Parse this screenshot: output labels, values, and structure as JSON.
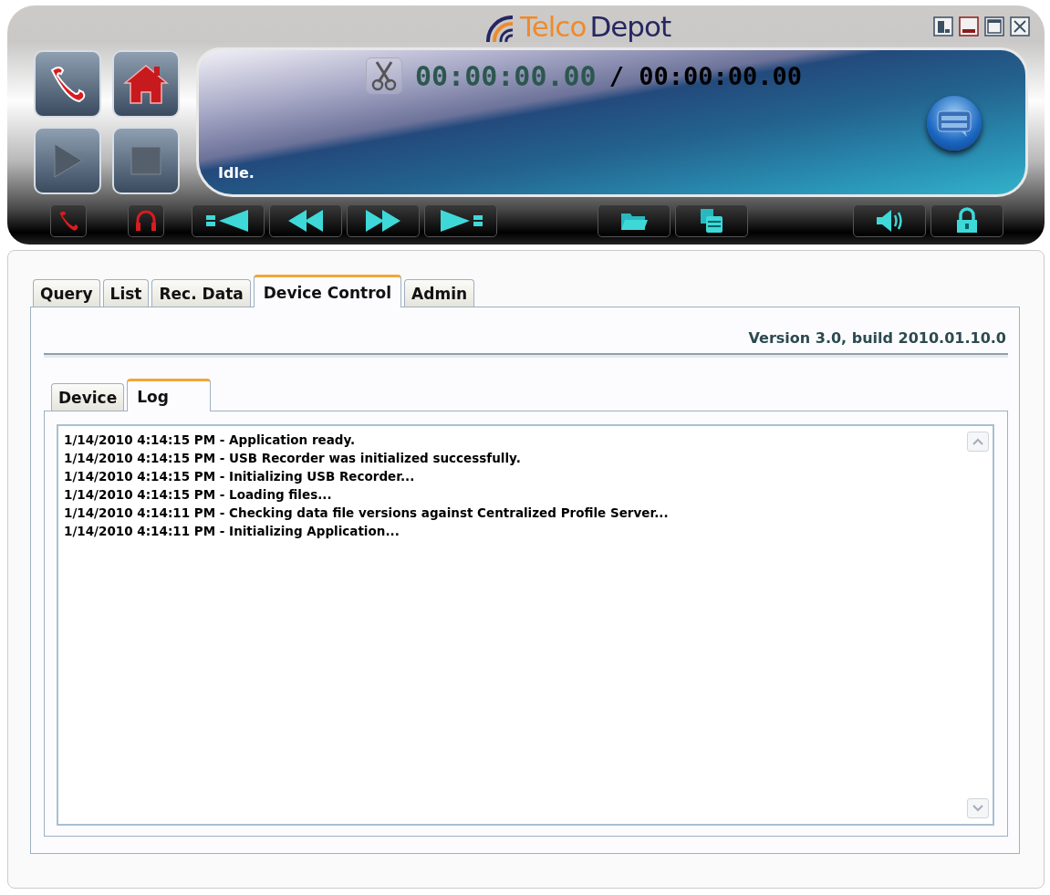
{
  "logo": {
    "part_1": "Telco",
    "part_2": "Depot"
  },
  "player": {
    "elapsed": "00:00:00.00",
    "total": "/ 00:00:00.00",
    "status": "Idle."
  },
  "tabs": [
    {
      "label": "Query",
      "selected": false
    },
    {
      "label": "List",
      "selected": false
    },
    {
      "label": "Rec. Data",
      "selected": false
    },
    {
      "label": "Device Control",
      "selected": true
    },
    {
      "label": "Admin",
      "selected": false
    }
  ],
  "version": "Version 3.0, build 2010.01.10.0",
  "subtabs": [
    {
      "label": "Device",
      "selected": false
    },
    {
      "label": "Log",
      "selected": true
    }
  ],
  "log": [
    "1/14/2010 4:14:15 PM - Application ready.",
    "1/14/2010 4:14:15 PM - USB Recorder was initialized successfully.",
    "1/14/2010 4:14:15 PM - Initializing USB Recorder...",
    "1/14/2010 4:14:15 PM - Loading files...",
    "1/14/2010 4:14:11 PM - Checking data file versions against Centralized Profile Server...",
    "1/14/2010 4:14:11 PM - Initializing Application..."
  ]
}
